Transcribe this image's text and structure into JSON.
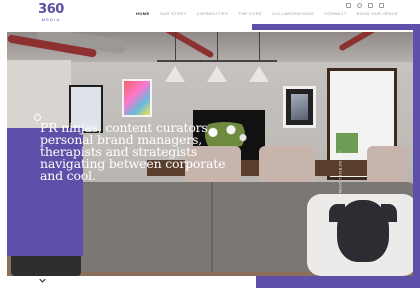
{
  "brand": {
    "logo_number": "360",
    "logo_sub": "MEDIA"
  },
  "nav": {
    "items": [
      {
        "label": "HOME",
        "active": true
      },
      {
        "label": "OUR STORY",
        "active": false
      },
      {
        "label": "CAPABILITIES",
        "active": false
      },
      {
        "label": "THE CORE",
        "active": false
      },
      {
        "label": "COLLABORATIONS",
        "active": false
      },
      {
        "label": "CONNECT",
        "active": false
      },
      {
        "label": "BOOK OUR SPACE",
        "active": false
      }
    ]
  },
  "social": {
    "icons": [
      "instagram-icon",
      "twitter-icon",
      "facebook-icon",
      "linkedin-icon"
    ]
  },
  "hero": {
    "headline": "PR ninjas, content curators, personal brand managers, therapists and strategists navigating between corporate and cool.",
    "quote_icon": "quote-circle-icon",
    "side_label": "—— SCROLL DOWN"
  },
  "colors": {
    "accent": "#5e50a8",
    "nav_active": "#222222",
    "nav_inactive": "#9a9a9a"
  },
  "scroll": {
    "icon": "chevron-down-icon"
  }
}
